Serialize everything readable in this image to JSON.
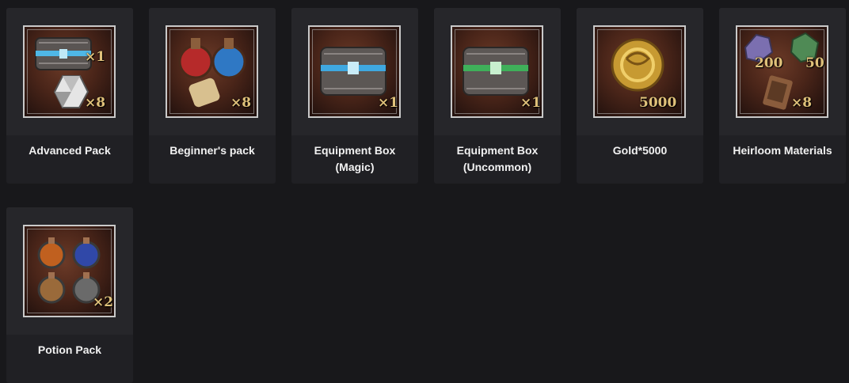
{
  "items": [
    {
      "label_line1": "Advanced Pack",
      "label_line2": "",
      "quantities": [
        "×1",
        "×8"
      ],
      "icons": [
        "treasure-chest-icon",
        "d20-dice-icon"
      ]
    },
    {
      "label_line1": "Beginner's pack",
      "label_line2": "",
      "quantities": [
        "×8"
      ],
      "icons": [
        "potion-flasks-icon",
        "scroll-icon"
      ]
    },
    {
      "label_line1": "Equipment Box",
      "label_line2": "(Magic)",
      "quantities": [
        "×1"
      ],
      "icons": [
        "blue-chest-icon"
      ]
    },
    {
      "label_line1": "Equipment Box",
      "label_line2": "(Uncommon)",
      "quantities": [
        "×1"
      ],
      "icons": [
        "green-chest-icon"
      ]
    },
    {
      "label_line1": "Gold*5000",
      "label_line2": "",
      "quantities": [
        "5000"
      ],
      "icons": [
        "gold-coin-icon"
      ]
    },
    {
      "label_line1": "Heirloom Materials",
      "label_line2": "",
      "quantities": [
        "200",
        "50",
        "×8"
      ],
      "icons": [
        "purple-ore-icon",
        "green-ore-icon",
        "rusty-scrap-icon"
      ]
    },
    {
      "label_line1": "Potion Pack",
      "label_line2": "",
      "quantities": [
        "×2"
      ],
      "icons": [
        "potion-bottles-icon"
      ]
    }
  ],
  "colors": {
    "background": "#18181b",
    "card": "#202024",
    "quantity_text": "#e0c17a"
  }
}
